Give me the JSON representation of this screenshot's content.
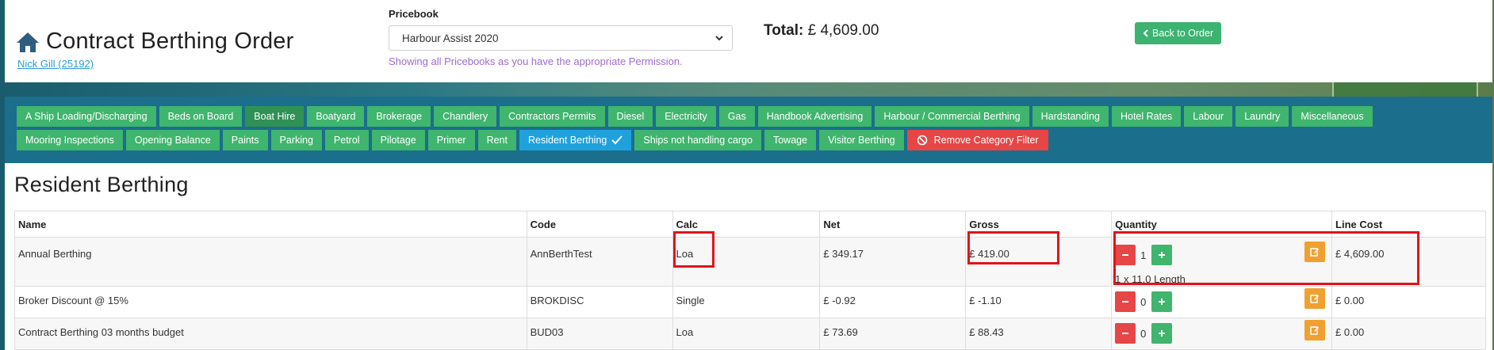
{
  "header": {
    "title": "Contract Berthing Order",
    "user_link": "Nick Gill (25192)",
    "pricebook_label": "Pricebook",
    "pricebook_selected": "Harbour Assist 2020",
    "pricebook_note": "Showing all Pricebooks as you have the appropriate Permission.",
    "total_label": "Total:",
    "total_value": "£ 4,609.00",
    "back_button": "Back to Order"
  },
  "categories": [
    {
      "label": "A Ship Loading/Discharging",
      "state": "normal"
    },
    {
      "label": "Beds on Board",
      "state": "normal"
    },
    {
      "label": "Boat Hire",
      "state": "dark"
    },
    {
      "label": "Boatyard",
      "state": "normal"
    },
    {
      "label": "Brokerage",
      "state": "normal"
    },
    {
      "label": "Chandlery",
      "state": "normal"
    },
    {
      "label": "Contractors Permits",
      "state": "normal"
    },
    {
      "label": "Diesel",
      "state": "normal"
    },
    {
      "label": "Electricity",
      "state": "normal"
    },
    {
      "label": "Gas",
      "state": "normal"
    },
    {
      "label": "Handbook Advertising",
      "state": "normal"
    },
    {
      "label": "Harbour / Commercial Berthing",
      "state": "normal"
    },
    {
      "label": "Hardstanding",
      "state": "normal"
    },
    {
      "label": "Hotel Rates",
      "state": "normal"
    },
    {
      "label": "Labour",
      "state": "normal"
    },
    {
      "label": "Laundry",
      "state": "normal"
    },
    {
      "label": "Miscellaneous",
      "state": "normal"
    },
    {
      "label": "Mooring Inspections",
      "state": "normal"
    },
    {
      "label": "Opening Balance",
      "state": "normal"
    },
    {
      "label": "Paints",
      "state": "normal"
    },
    {
      "label": "Parking",
      "state": "normal"
    },
    {
      "label": "Petrol",
      "state": "normal"
    },
    {
      "label": "Pilotage",
      "state": "normal"
    },
    {
      "label": "Primer",
      "state": "normal"
    },
    {
      "label": "Rent",
      "state": "normal"
    },
    {
      "label": "Resident Berthing",
      "state": "active"
    },
    {
      "label": "Ships not handling cargo",
      "state": "normal"
    },
    {
      "label": "Towage",
      "state": "normal"
    },
    {
      "label": "Visitor Berthing",
      "state": "normal"
    },
    {
      "label": "Remove Category Filter",
      "state": "remove"
    }
  ],
  "section_title": "Resident Berthing",
  "table": {
    "columns": [
      "Name",
      "Code",
      "Calc",
      "Net",
      "Gross",
      "Quantity",
      "Line Cost"
    ],
    "rows": [
      {
        "name": "Annual Berthing",
        "code": "AnnBerthTest",
        "calc": "Loa",
        "net": "£ 349.17",
        "gross": "£ 419.00",
        "qty": "1",
        "qty_note": "1 x 11.0 Length",
        "line_cost": "£ 4,609.00"
      },
      {
        "name": "Broker Discount @ 15%",
        "code": "BROKDISC",
        "calc": "Single",
        "net": "£ -0.92",
        "gross": "£ -1.10",
        "qty": "0",
        "qty_note": "",
        "line_cost": "£ 0.00"
      },
      {
        "name": "Contract Berthing 03 months budget",
        "code": "BUD03",
        "calc": "Loa",
        "net": "£ 73.69",
        "gross": "£ 88.43",
        "qty": "0",
        "qty_note": "",
        "line_cost": "£ 0.00"
      }
    ]
  },
  "colors": {
    "chip_green": "#3fb56d",
    "chip_active": "#1fa2dc",
    "chip_remove": "#e64646",
    "category_bar": "#1b6e8c",
    "highlight": "#e0141a",
    "edit_button": "#f0a030"
  },
  "icons": [
    "home-icon",
    "chevron-down-icon",
    "chevron-left-icon",
    "check-icon",
    "ban-icon",
    "minus-icon",
    "plus-icon",
    "edit-icon"
  ]
}
